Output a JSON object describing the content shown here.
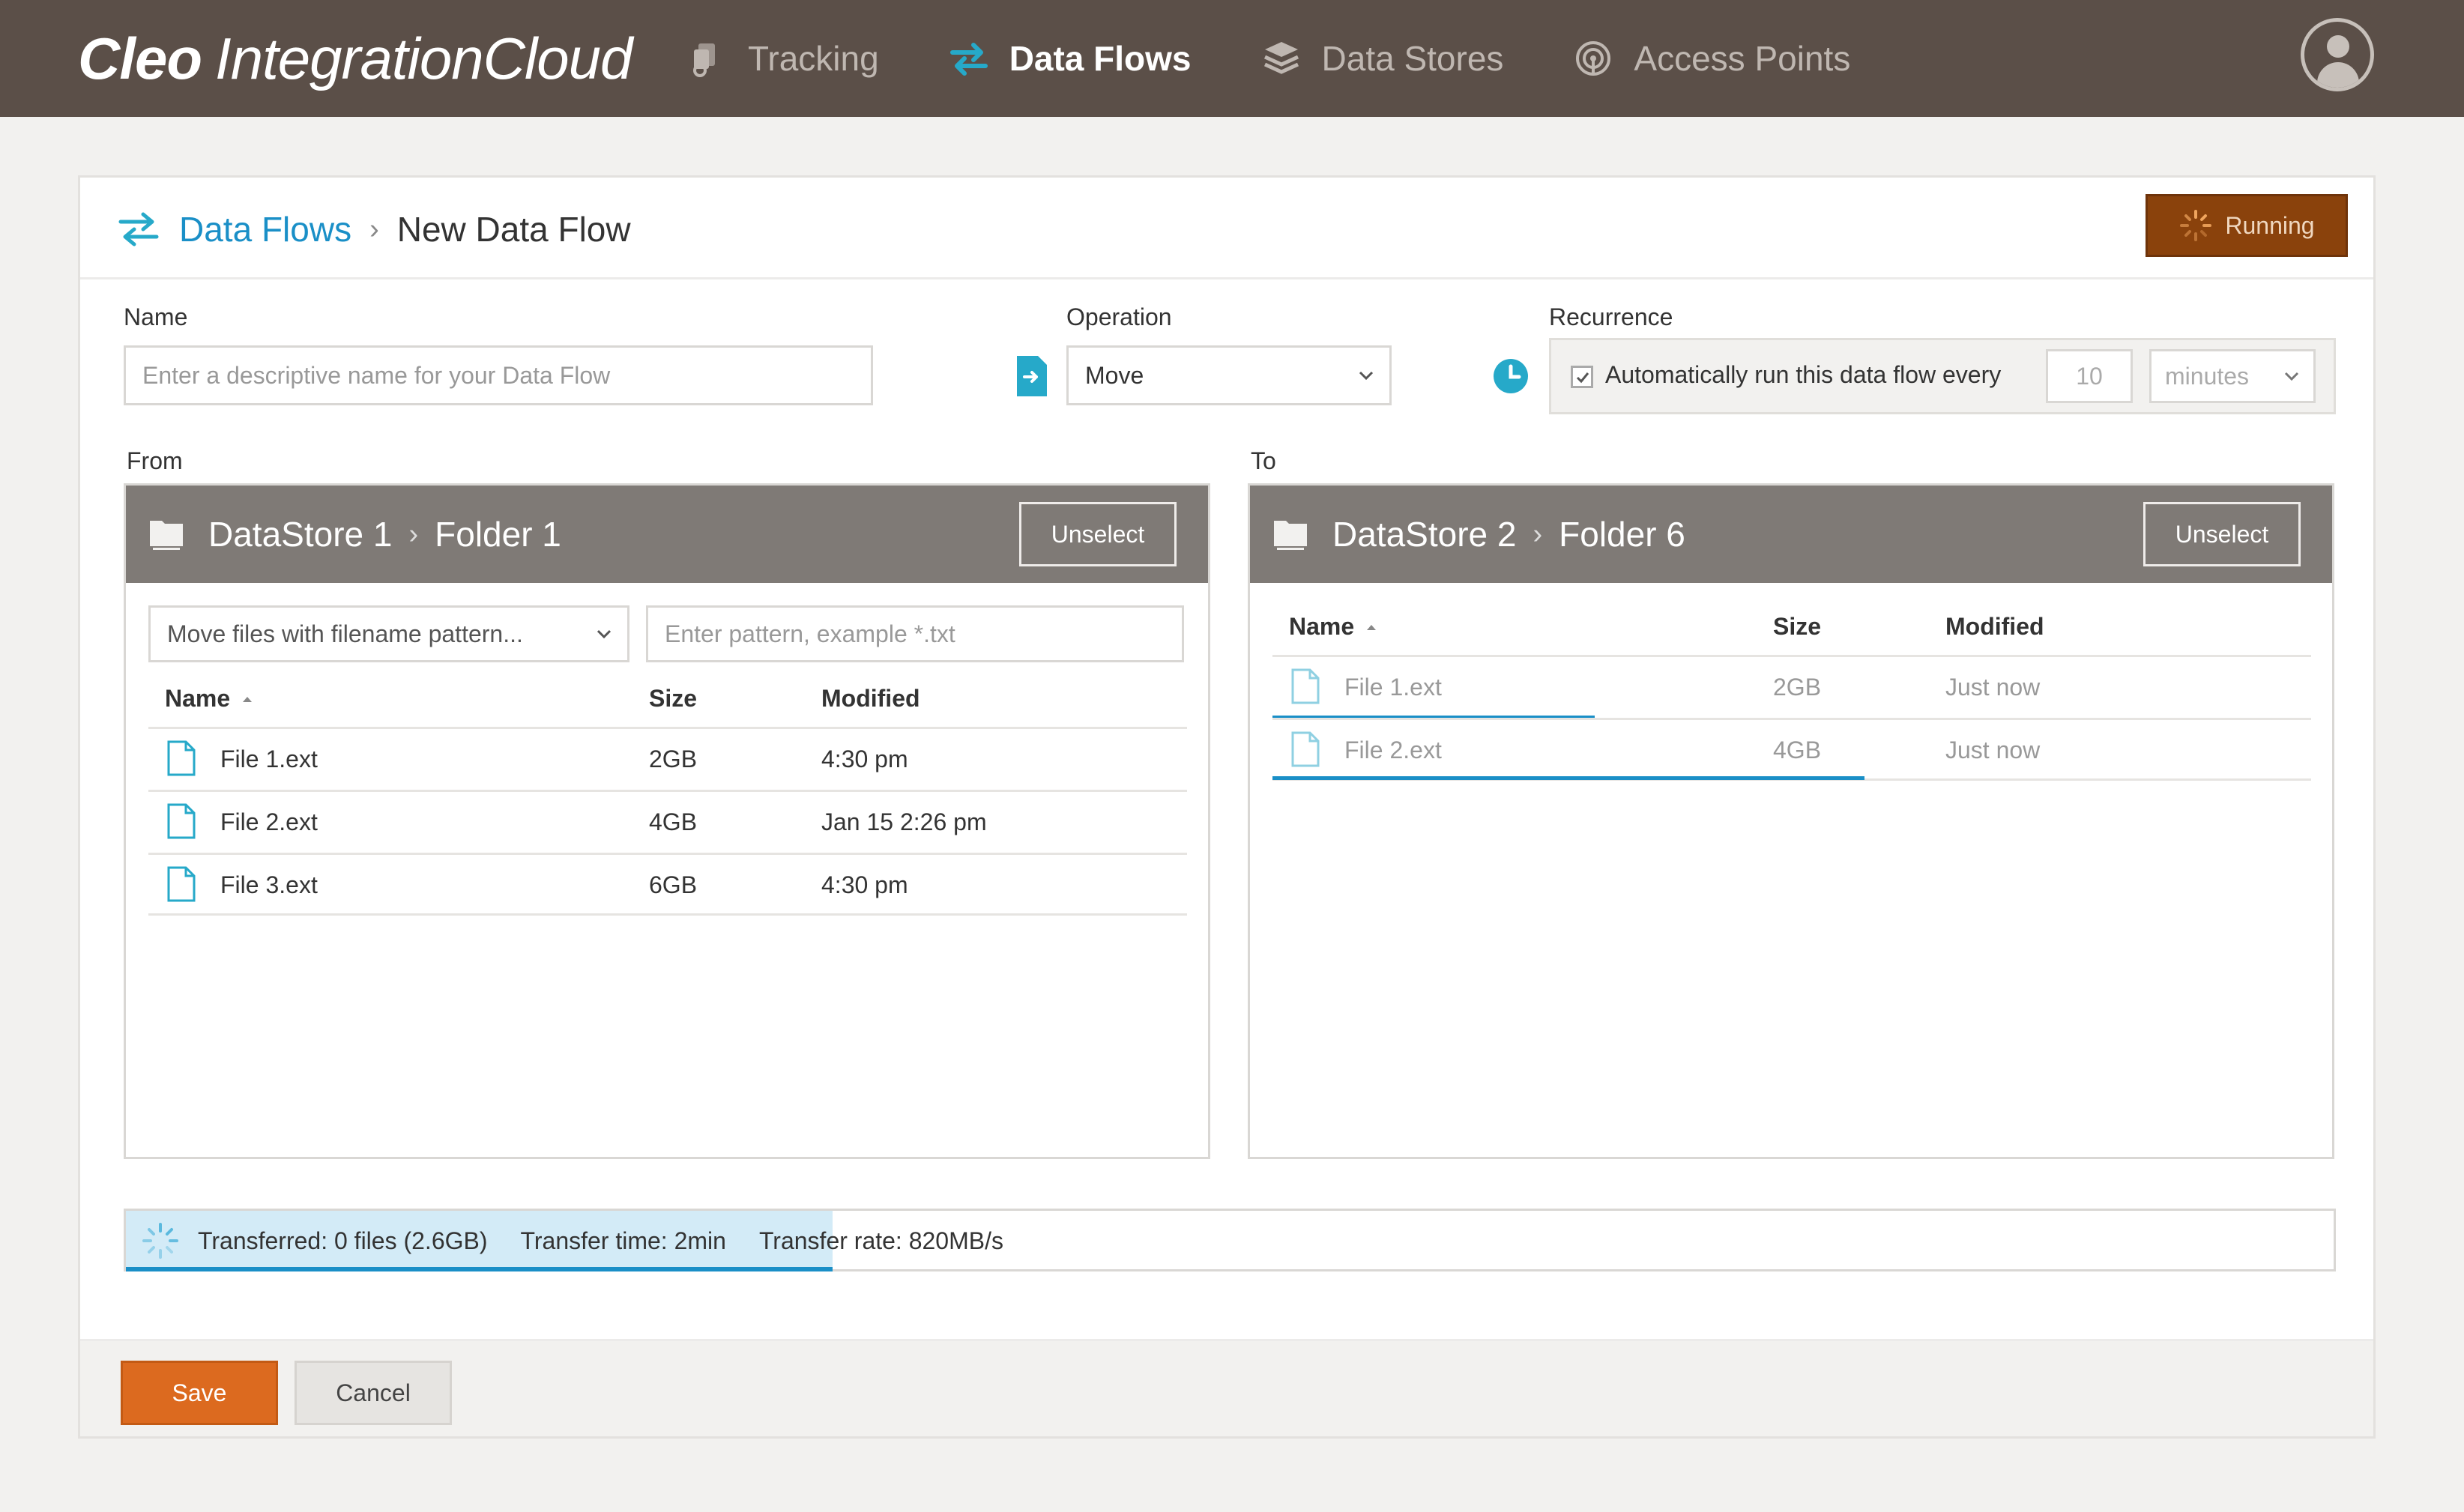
{
  "app": {
    "logo_bold": "Cleo",
    "logo_rest": "IntegrationCloud"
  },
  "nav": {
    "items": [
      {
        "label": "Tracking",
        "icon": "tracking-icon",
        "active": false
      },
      {
        "label": "Data Flows",
        "icon": "data-flows-icon",
        "active": true
      },
      {
        "label": "Data Stores",
        "icon": "data-stores-icon",
        "active": false
      },
      {
        "label": "Access Points",
        "icon": "access-points-icon",
        "active": false
      }
    ]
  },
  "breadcrumb": {
    "parent": "Data Flows",
    "separator": "›",
    "current": "New Data Flow"
  },
  "status_button": {
    "label": "Running"
  },
  "form": {
    "name_label": "Name",
    "name_placeholder": "Enter a descriptive name for your Data Flow",
    "operation_label": "Operation",
    "operation_value": "Move",
    "recurrence_label": "Recurrence",
    "recurrence_checked": true,
    "recurrence_text": "Automatically run this data flow every",
    "recurrence_interval": "10",
    "recurrence_unit": "minutes"
  },
  "from": {
    "label": "From",
    "datastore": "DataStore 1",
    "separator": "›",
    "folder": "Folder 1",
    "unselect_label": "Unselect",
    "filter_select": "Move files with filename pattern...",
    "pattern_placeholder": "Enter pattern, example *.txt",
    "columns": [
      "Name",
      "Size",
      "Modified"
    ],
    "rows": [
      {
        "name": "File 1.ext",
        "size": "2GB",
        "modified": "4:30 pm"
      },
      {
        "name": "File 2.ext",
        "size": "4GB",
        "modified": "Jan 15 2:26 pm"
      },
      {
        "name": "File 3.ext",
        "size": "6GB",
        "modified": "4:30 pm"
      }
    ]
  },
  "to": {
    "label": "To",
    "datastore": "DataStore 2",
    "separator": "›",
    "folder": "Folder 6",
    "unselect_label": "Unselect",
    "columns": [
      "Name",
      "Size",
      "Modified"
    ],
    "rows": [
      {
        "name": "File 1.ext",
        "size": "2GB",
        "modified": "Just now",
        "progress": 0.31
      },
      {
        "name": "File 2.ext",
        "size": "4GB",
        "modified": "Just now",
        "progress": 0.57
      }
    ]
  },
  "transfer": {
    "transferred": "Transferred: 0 files (2.6GB)",
    "time": "Transfer time: 2min",
    "rate": "Transfer rate: 820MB/s",
    "progress": 0.32
  },
  "footer": {
    "save_label": "Save",
    "cancel_label": "Cancel"
  },
  "colors": {
    "topbar": "#5b4f48",
    "accent_blue": "#1a8fc7",
    "teal_icon": "#26a9c9",
    "save": "#dc6a1f",
    "running": "#8a420c",
    "panel_header": "#7f7a76"
  }
}
